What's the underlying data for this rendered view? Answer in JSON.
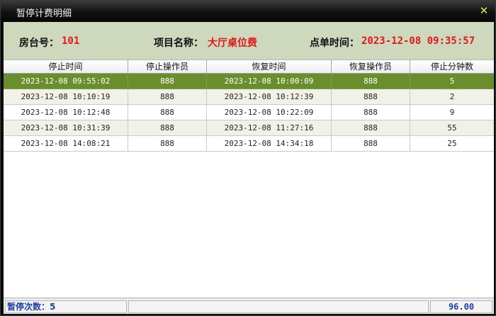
{
  "window": {
    "title": "暂停计费明细",
    "close_glyph": "✕"
  },
  "info": {
    "room_label": "房台号：",
    "room_value": "101",
    "item_label": "项目名称：",
    "item_value": "大厅桌位费",
    "order_time_label": "点单时间：",
    "order_time_value": "2023-12-08 09:35:57"
  },
  "table": {
    "headers": [
      "停止时间",
      "停止操作员",
      "恢复时间",
      "恢复操作员",
      "停止分钟数"
    ],
    "rows": [
      [
        "2023-12-08 09:55:02",
        "888",
        "2023-12-08 10:00:09",
        "888",
        "5"
      ],
      [
        "2023-12-08 10:10:19",
        "888",
        "2023-12-08 10:12:39",
        "888",
        "2"
      ],
      [
        "2023-12-08 10:12:48",
        "888",
        "2023-12-08 10:22:09",
        "888",
        "9"
      ],
      [
        "2023-12-08 10:31:39",
        "888",
        "2023-12-08 11:27:16",
        "888",
        "55"
      ],
      [
        "2023-12-08 14:08:21",
        "888",
        "2023-12-08 14:34:18",
        "888",
        "25"
      ]
    ],
    "selected_row": 0
  },
  "status": {
    "pause_count": "暂停次数：5",
    "total": "96.00"
  },
  "colors": {
    "accent_value": "#e01818",
    "selected_row": "#6b8e2d",
    "status_text": "#1c3fa8"
  }
}
